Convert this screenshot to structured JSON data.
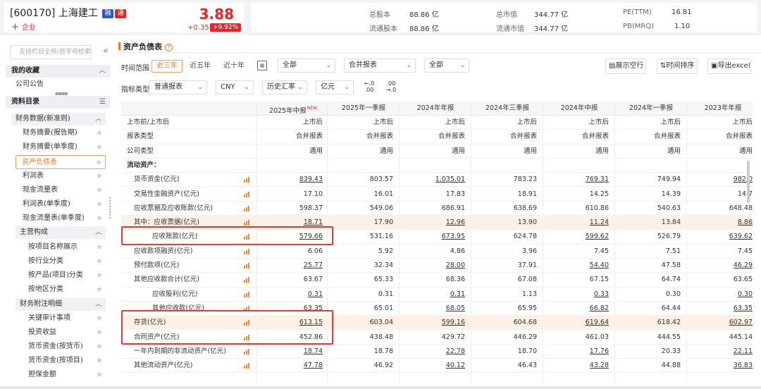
{
  "stock": {
    "code_name": "[600170] 上海建工",
    "tag_rong": "融",
    "tag_tong": "通",
    "add_label": "企业",
    "price": "3.88",
    "change_abs": "+0.35",
    "change_pct": "+9.92%"
  },
  "stats": {
    "total_shares_label": "总股本",
    "total_shares": "88.86 亿",
    "float_shares_label": "流通股本",
    "float_shares": "88.86 亿",
    "market_cap_label": "总市值",
    "market_cap": "344.77 亿",
    "float_cap_label": "流通市值",
    "float_cap": "344.77 亿",
    "pe_label": "PE(TTM)",
    "pe": "16.81",
    "pb_label": "PB(MRQ)",
    "pb": "1.10"
  },
  "sidebar": {
    "search_placeholder": "支持栏目全称/首字母检索",
    "favorites_title": "我的收藏",
    "favorites_items": [
      "公司公告"
    ],
    "catalog_title": "资料目录",
    "fin_group": "财务数据(新准则)",
    "fin_items": [
      "财务摘要(报告期)",
      "财务摘要(单季度)",
      "资产负债表",
      "利润表",
      "现金流量表",
      "利润表(单季度)",
      "现金流量表(单季度)"
    ],
    "biz_group": "主营构成",
    "biz_items": [
      "按项目名称展示",
      "按行业分类",
      "按产品(项目)分类",
      "按地区分类"
    ],
    "notes_group": "财务附注明细",
    "notes_items": [
      "关键审计事项",
      "投资收益",
      "货币资金(按货币)",
      "货币资金(按项目)",
      "担保金额"
    ]
  },
  "main": {
    "title": "资产负债表",
    "help": "?",
    "time_range_label": "时间范围",
    "ranges": [
      "近三年",
      "近五年",
      "近十年"
    ],
    "filter_all_1": "全部",
    "filter_report": "合并报表",
    "filter_all_2": "全部",
    "indicator_type_label": "指标类型",
    "indicator_type": "普通报表",
    "currency": "CNY",
    "fx": "历史汇率",
    "unit": "亿元",
    "dec_less": [
      "←.0",
      ".00"
    ],
    "dec_more": [
      ".00",
      "→.0"
    ],
    "btn_show_empty": "展示空行",
    "btn_time_sort": "时间排序",
    "btn_export": "导出excel"
  },
  "table": {
    "columns": [
      "2025年中报",
      "2025年一季报",
      "2024年年报",
      "2024年三季报",
      "2024年中报",
      "2024年一季报",
      "2023年年报"
    ],
    "new_badge": "NEW",
    "rows": [
      {
        "label": "上市前/上市后",
        "indent": 0,
        "values": [
          "上市后",
          "上市后",
          "上市后",
          "上市后",
          "上市后",
          "上市后",
          "上市后"
        ]
      },
      {
        "label": "报表类型",
        "indent": 0,
        "values": [
          "合并报表",
          "合并报表",
          "合并报表",
          "合并报表",
          "合并报表",
          "合并报表",
          "合并报表"
        ]
      },
      {
        "label": "公司类型",
        "indent": 0,
        "values": [
          "通用",
          "通用",
          "通用",
          "通用",
          "通用",
          "通用",
          "通用"
        ]
      },
      {
        "label": "流动资产：",
        "indent": 0,
        "bold": true,
        "values": [
          "",
          "",
          "",
          "",
          "",
          "",
          ""
        ]
      },
      {
        "label": "货币资金(亿元)",
        "indent": 1,
        "chart": true,
        "values": [
          "839.43",
          "803.57",
          "1,035.01",
          "783.23",
          "769.31",
          "749.94",
          "982.0"
        ],
        "u": [
          true,
          false,
          true,
          false,
          true,
          false,
          true
        ]
      },
      {
        "label": "交易性金融资产(亿元)",
        "indent": 1,
        "chart": true,
        "values": [
          "17.10",
          "16.01",
          "17.83",
          "18.91",
          "14.25",
          "14.39",
          "14.7"
        ]
      },
      {
        "label": "应收票据及应收账款(亿元)",
        "indent": 1,
        "chart": true,
        "values": [
          "598.37",
          "549.06",
          "686.91",
          "638.69",
          "610.86",
          "540.63",
          "648.48"
        ]
      },
      {
        "label": "其中：应收票据(亿元)",
        "indent": 1,
        "chart": true,
        "hl": true,
        "values": [
          "18.71",
          "17.90",
          "12.96",
          "13.90",
          "11.24",
          "13.84",
          "8.86"
        ],
        "u": [
          true,
          false,
          true,
          false,
          true,
          false,
          true
        ]
      },
      {
        "label": "应收账款(亿元)",
        "indent": 2,
        "chart": true,
        "values": [
          "579.66",
          "531.16",
          "673.95",
          "624.78",
          "599.62",
          "526.79",
          "639.62"
        ],
        "u": [
          true,
          false,
          true,
          false,
          true,
          false,
          true
        ]
      },
      {
        "label": "应收款项融资(亿元)",
        "indent": 1,
        "chart": true,
        "values": [
          "6.06",
          "5.92",
          "4.86",
          "3.96",
          "7.45",
          "7.51",
          "7.45"
        ]
      },
      {
        "label": "预付款项(亿元)",
        "indent": 1,
        "chart": true,
        "values": [
          "25.77",
          "32.34",
          "28.00",
          "37.91",
          "54.40",
          "47.58",
          "46.29"
        ],
        "u": [
          true,
          false,
          true,
          false,
          true,
          false,
          true
        ]
      },
      {
        "label": "其他应收款合计(亿元)",
        "indent": 1,
        "chart": true,
        "values": [
          "63.67",
          "65.33",
          "68.36",
          "67.08",
          "67.15",
          "64.74",
          "63.65"
        ]
      },
      {
        "label": "应收股利(亿元)",
        "indent": 2,
        "chart": true,
        "values": [
          "0.31",
          "0.31",
          "0.31",
          "1.13",
          "0.33",
          "0.30",
          "0.30"
        ],
        "u": [
          true,
          false,
          true,
          false,
          true,
          false,
          true
        ]
      },
      {
        "label": "其他应收款(亿元)",
        "indent": 2,
        "chart": true,
        "values": [
          "63.35",
          "65.01",
          "68.05",
          "65.95",
          "66.82",
          "64.44",
          "63.35"
        ],
        "u": [
          true,
          false,
          true,
          false,
          true,
          false,
          true
        ]
      },
      {
        "label": "存货(亿元)",
        "indent": 1,
        "chart": true,
        "hl": true,
        "values": [
          "613.15",
          "603.04",
          "599.16",
          "604.68",
          "619.64",
          "618.42",
          "602.97"
        ],
        "u": [
          true,
          false,
          true,
          false,
          true,
          false,
          true
        ]
      },
      {
        "label": "合同资产(亿元)",
        "indent": 1,
        "chart": true,
        "values": [
          "452.86",
          "438.48",
          "429.72",
          "446.29",
          "461.03",
          "444.55",
          "445.14"
        ]
      },
      {
        "label": "一年内到期的非流动资产(亿元)",
        "indent": 1,
        "chart": true,
        "values": [
          "18.74",
          "18.78",
          "22.78",
          "18.70",
          "17.76",
          "20.33",
          "22.11"
        ],
        "u": [
          true,
          false,
          true,
          false,
          true,
          false,
          true
        ]
      },
      {
        "label": "其他流动资产(亿元)",
        "indent": 1,
        "chart": true,
        "values": [
          "47.78",
          "46.92",
          "40.12",
          "46.43",
          "43.28",
          "44.88",
          "36.83"
        ],
        "u": [
          true,
          false,
          true,
          false,
          true,
          false,
          true
        ]
      }
    ]
  }
}
